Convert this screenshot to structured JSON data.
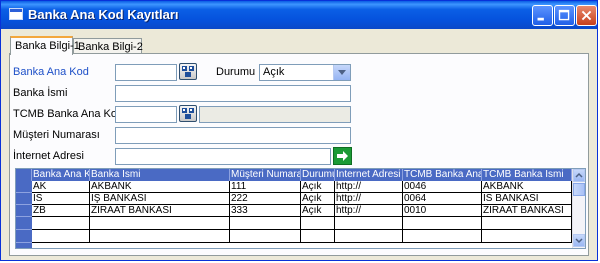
{
  "window": {
    "title": "Banka Ana Kod Kayıtları"
  },
  "tabs": [
    {
      "label": "Banka Bilgi-1"
    },
    {
      "label": "Banka Bilgi-2"
    }
  ],
  "form": {
    "banka_ana_kod_label": "Banka Ana Kod",
    "banka_ana_kod_value": "",
    "durumu_label": "Durumu",
    "durumu_value": "Açık",
    "banka_ismi_label": "Banka İsmi",
    "banka_ismi_value": "",
    "tcmb_label": "TCMB Banka Ana Kod",
    "tcmb_value": "",
    "tcmb_desc_value": "",
    "musteri_label": "Müşteri Numarası",
    "musteri_value": "",
    "internet_label": "İnternet Adresi",
    "internet_value": ""
  },
  "grid": {
    "columns": [
      "Banka Ana Kod",
      "Banka İsmi",
      "Müşteri Numarası",
      "Durumu",
      "İnternet Adresi",
      "TCMB Banka Ana K",
      "TCMB Banka İsmi"
    ],
    "rows": [
      [
        "AK",
        "AKBANK",
        "111",
        "Açık",
        "http://",
        "0046",
        "AKBANK"
      ],
      [
        "IS",
        "İŞ BANKASI",
        "222",
        "Açık",
        "http://",
        "0064",
        "IS BANKASI"
      ],
      [
        "ZB",
        "ZİRAAT BANKASI",
        "333",
        "Açık",
        "http://",
        "0010",
        "ZIRAAT BANKASI"
      ],
      [
        "",
        "",
        "",
        "",
        "",
        "",
        ""
      ],
      [
        "",
        "",
        "",
        "",
        "",
        "",
        ""
      ]
    ]
  },
  "colors": {
    "titlebar": "#0551dc",
    "grid_header": "#4a6ac4",
    "label_accent": "#1e50c8"
  }
}
